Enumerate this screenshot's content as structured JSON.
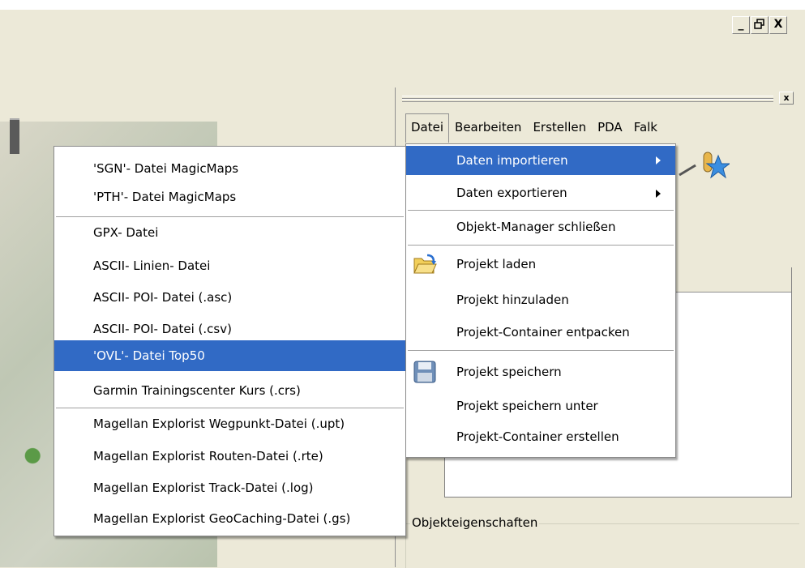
{
  "window": {
    "controls": {
      "minimize": "_",
      "restore": " ",
      "close": "X"
    }
  },
  "pane": {
    "close": "x"
  },
  "menubar": [
    "Datei",
    "Bearbeiten",
    "Erstellen",
    "PDA",
    "Falk"
  ],
  "file_menu": {
    "items": [
      {
        "label": "Daten importieren",
        "submenu": true,
        "selected": true
      },
      {
        "label": "Daten exportieren",
        "submenu": true
      },
      {
        "label": "Objekt-Manager schließen"
      },
      {
        "label": "Projekt laden",
        "icon": "folder-open-icon"
      },
      {
        "label": "Projekt hinzuladen"
      },
      {
        "label": "Projekt-Container entpacken"
      },
      {
        "label": "Projekt speichern",
        "icon": "floppy-disk-icon"
      },
      {
        "label": "Projekt speichern unter"
      },
      {
        "label": "Projekt-Container erstellen"
      }
    ]
  },
  "import_submenu": {
    "items": [
      {
        "label": "'SGN'- Datei MagicMaps"
      },
      {
        "label": "'PTH'- Datei MagicMaps"
      },
      {
        "label": "GPX- Datei"
      },
      {
        "label": "ASCII- Linien- Datei"
      },
      {
        "label": "ASCII- POI- Datei (.asc)"
      },
      {
        "label": "ASCII- POI- Datei (.csv)"
      },
      {
        "label": "'OVL'- Datei Top50",
        "selected": true
      },
      {
        "label": "Garmin Trainingscenter Kurs (.crs)"
      },
      {
        "label": "Magellan Explorist Wegpunkt-Datei (.upt)"
      },
      {
        "label": "Magellan Explorist Routen-Datei (.rte)"
      },
      {
        "label": "Magellan Explorist Track-Datei (.log)"
      },
      {
        "label": "Magellan Explorist GeoCaching-Datei (.gs)"
      }
    ]
  },
  "properties_group": {
    "label": "Objekteigenschaften"
  },
  "colors": {
    "selection": "#316ac5",
    "face": "#ece9d8"
  }
}
